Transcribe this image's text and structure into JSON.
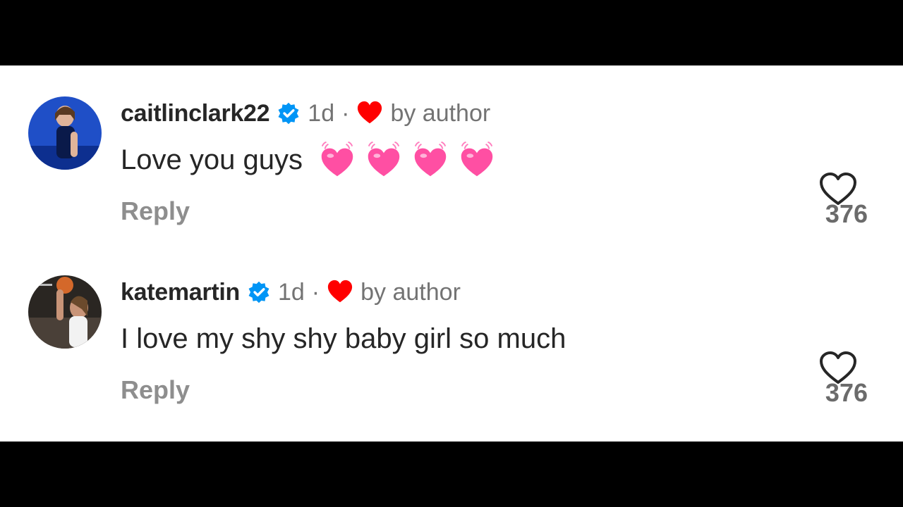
{
  "comments": [
    {
      "username": "caitlinclark22",
      "time": "1d",
      "separator": "·",
      "liked_label": "by author",
      "text": "Love you guys",
      "emoji_count": 4,
      "reply_label": "Reply",
      "like_count": "376",
      "avatar_icon": "profile-photo",
      "verified_icon": "verified-badge-icon"
    },
    {
      "username": "katemartin",
      "time": "1d",
      "separator": "·",
      "liked_label": "by author",
      "text": "I love my shy shy baby girl so much",
      "emoji_count": 0,
      "reply_label": "Reply",
      "like_count": "376",
      "avatar_icon": "profile-photo",
      "verified_icon": "verified-badge-icon"
    }
  ],
  "colors": {
    "verified": "#0095f6",
    "liked_heart": "#ff0000",
    "emoji_heart": "#ff4fa3",
    "muted_text": "#737373"
  }
}
